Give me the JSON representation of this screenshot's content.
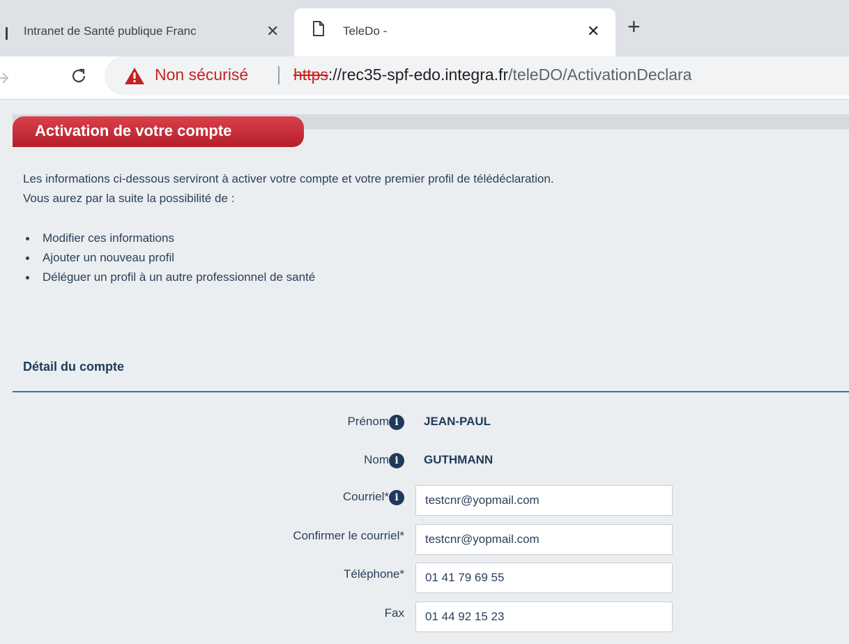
{
  "browser": {
    "tabs": [
      {
        "title": "Intranet de Santé publique Franc",
        "active": false
      },
      {
        "title": "TeleDo -",
        "active": true
      }
    ],
    "close_glyph": "✕",
    "new_tab_glyph": "+",
    "address_bar": {
      "security_label": "Non sécurisé",
      "url_scheme": "https",
      "url_separator": "://",
      "url_host": "rec35-spf-edo.integra.fr",
      "url_path": "/teleDO/ActivationDeclara"
    }
  },
  "page": {
    "title": "Activation de votre compte",
    "intro_lines": [
      "Les informations ci-dessous serviront à activer votre compte et votre premier profil de télédéclaration.",
      "Vous aurez par la suite la possibilité de :"
    ],
    "bullets": [
      "Modifier ces informations",
      "Ajouter un nouveau profil",
      "Déléguer un profil à un autre professionnel de santé"
    ],
    "section_title": "Détail du compte",
    "fields": {
      "prenom": {
        "label": "Prénom",
        "value": "JEAN-PAUL"
      },
      "nom": {
        "label": "Nom",
        "value": "GUTHMANN"
      },
      "courriel": {
        "label": "Courriel*",
        "value": "testcnr@yopmail.com"
      },
      "confirm_courriel": {
        "label": "Confirmer le courriel*",
        "value": "testcnr@yopmail.com"
      },
      "telephone": {
        "label": "Téléphone*",
        "value": "01 41 79 69 55"
      },
      "fax": {
        "label": "Fax",
        "value": "01 44 92 15 23"
      }
    },
    "info_glyph": "i"
  },
  "colors": {
    "title_tab": "#c52c37",
    "text": "#2a3f5a",
    "section_rule": "#3d6f98",
    "page_bg": "#ebeef0",
    "warning": "#c5221f"
  },
  "icons": [
    "page-icon",
    "close-icon",
    "plus-icon",
    "forward-icon",
    "reload-icon",
    "warning-icon",
    "info-icon"
  ]
}
